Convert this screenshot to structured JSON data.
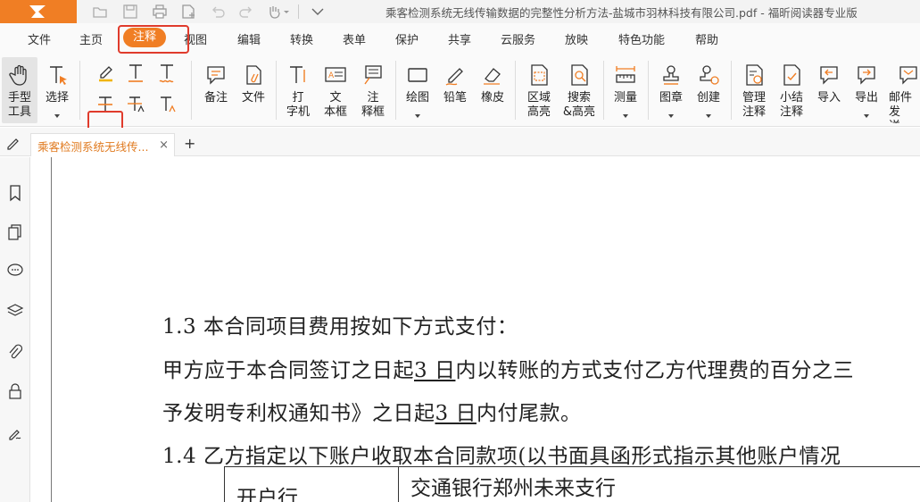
{
  "app": {
    "title": "乘客检测系统无线传输数据的完整性分析方法-盐城市羽林科技有限公司.pdf - 福昕阅读器专业版",
    "accent": "#f07e24",
    "highlight_box_color": "#e03b2c"
  },
  "quick_access": [
    "open-icon",
    "save-icon",
    "print-icon",
    "new-icon",
    "undo-icon",
    "redo-icon",
    "hand-dropdown-icon",
    "customize-icon"
  ],
  "menu": {
    "tabs": [
      "文件",
      "主页",
      "注释",
      "视图",
      "编辑",
      "转换",
      "表单",
      "保护",
      "共享",
      "云服务",
      "放映",
      "特色功能",
      "帮助"
    ],
    "active": "注释"
  },
  "ribbon": {
    "hand": "手型\n工具",
    "select": "选择",
    "note": "备注",
    "file": "文件",
    "typewriter": "打\n字机",
    "textbox": "文\n本框",
    "callout": "注\n释框",
    "drawing": "绘图",
    "pencil": "铅笔",
    "eraser": "橡皮",
    "area_highlight": "区域\n高亮",
    "search_highlight": "搜索\n&高亮",
    "measure": "测量",
    "stamp": "图章",
    "create": "创建",
    "manage": "管理\n注释",
    "summary": "小结\n注释",
    "import": "导入",
    "export": "导出",
    "email": "邮件发\n送FDF"
  },
  "doc_tab": {
    "label": "乘客检测系统无线传...",
    "close": "×",
    "new": "+"
  },
  "document": {
    "line1": "1.3 本合同项目费用按如下方式支付：",
    "line2_a": "甲方应于本合同签订之日起",
    "line2_u": "3 日",
    "line2_b": "内以转账的方式支付乙方代理费的百分之三",
    "line3_a": "予发明专利权通知书》之日起",
    "line3_u": "3 日",
    "line3_b": "内付尾款。",
    "line4": "1.4 乙方指定以下账户收取本合同款项(以书面具函形式指示其他账户情况",
    "table_label": "开户行",
    "table_value": "交通银行郑州未来支行"
  }
}
